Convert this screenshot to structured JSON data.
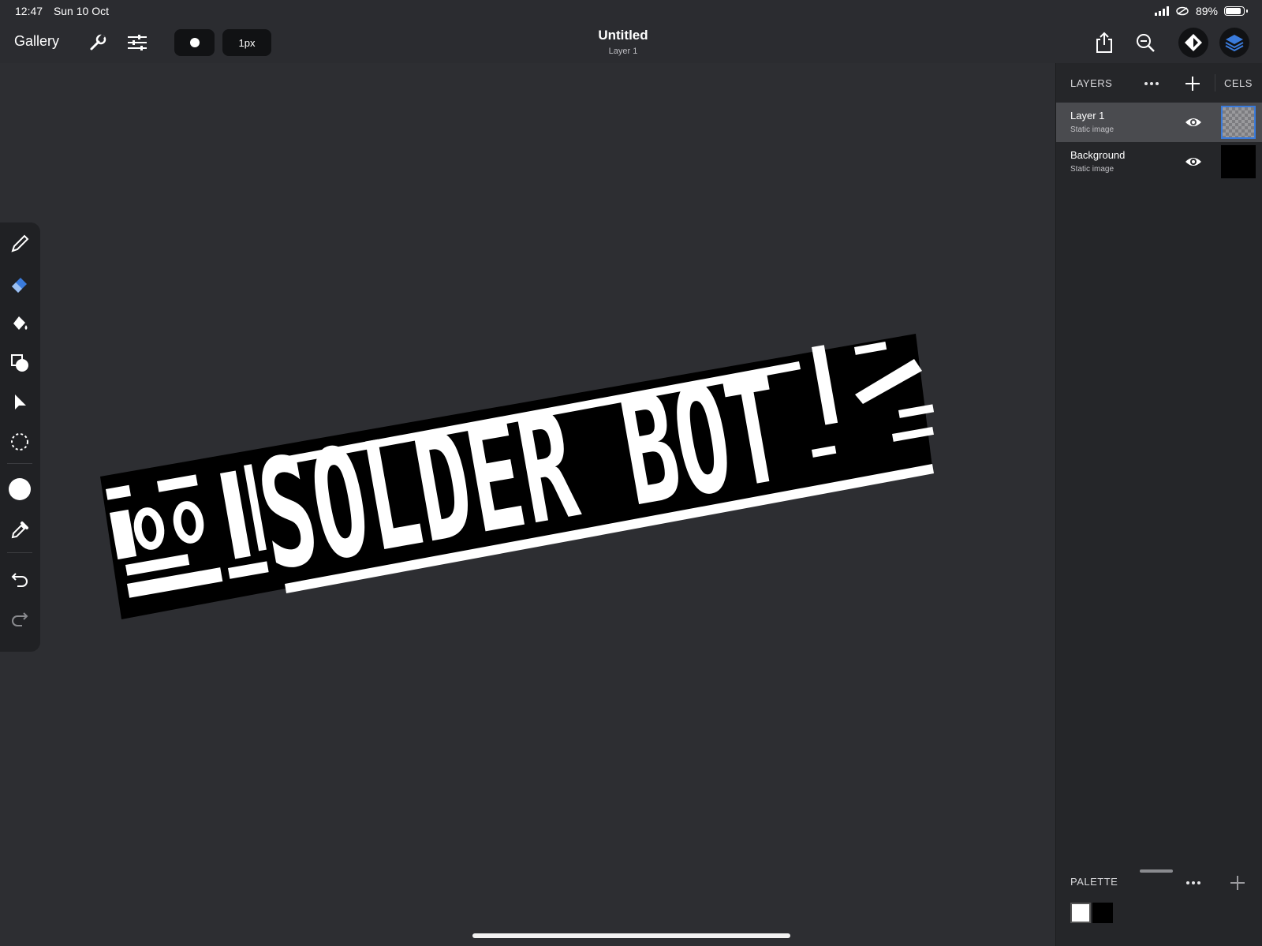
{
  "status": {
    "time": "12:47",
    "date": "Sun 10 Oct",
    "battery": "89%",
    "battery_level": 0.89
  },
  "toolbar": {
    "gallery_label": "Gallery",
    "brush_size": "1px",
    "title": "Untitled",
    "subtitle": "Layer 1"
  },
  "canvas": {
    "artwork_text": "SOLDER BOT"
  },
  "layers_panel": {
    "header": "LAYERS",
    "cels_label": "CELS",
    "layers": [
      {
        "name": "Layer 1",
        "type": "Static image",
        "selected": true
      },
      {
        "name": "Background",
        "type": "Static image",
        "selected": false
      }
    ]
  },
  "palette": {
    "header": "PALETTE",
    "colors": [
      "#ffffff",
      "#000000"
    ]
  },
  "colors": {
    "accent": "#3a7bdc",
    "selected_row": "#4a4b4f",
    "panel_bg": "#252629",
    "canvas_bg": "#2d2e32"
  }
}
